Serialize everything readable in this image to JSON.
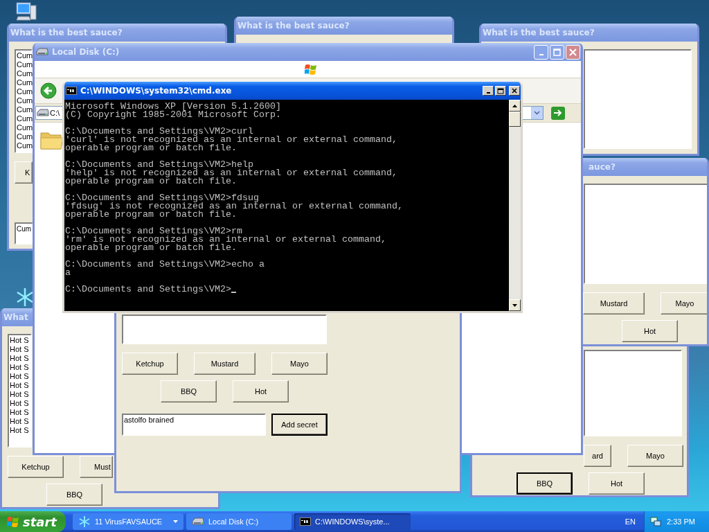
{
  "desktop": {
    "windows": [
      {
        "kind": "console",
        "title": "C:\\WINDOWS\\system32\\cmd.exe",
        "active": true,
        "blocks": [
          [
            "Microsoft Windows XP [Version 5.1.2600]",
            "(C) Copyright 1985-2001 Microsoft Corp."
          ],
          [
            "C:\\Documents and Settings\\VM2>curl",
            "'curl' is not recognized as an internal or external command,",
            "operable program or batch file."
          ],
          [
            "C:\\Documents and Settings\\VM2>help",
            "'help' is not recognized as an internal or external command,",
            "operable program or batch file."
          ],
          [
            "C:\\Documents and Settings\\VM2>fdsug",
            "'fdsug' is not recognized as an internal or external command,",
            "operable program or batch file."
          ],
          [
            "C:\\Documents and Settings\\VM2>rm",
            "'rm' is not recognized as an internal or external command,",
            "operable program or batch file."
          ],
          [
            "C:\\Documents and Settings\\VM2>echo a",
            "a"
          ],
          [
            "C:\\Documents and Settings\\VM2>"
          ]
        ]
      },
      {
        "kind": "sauce",
        "active": false,
        "buttons": [
          {
            "label": "Ketchup",
            "focused": false
          },
          {
            "label": "Mustard",
            "focused": false
          },
          {
            "label": "Mayo",
            "focused": false
          },
          {
            "label": "BBQ",
            "focused": false
          },
          {
            "label": "Hot",
            "focused": false
          }
        ],
        "field": {
          "value": "astolfo brained"
        },
        "submit_button": {
          "label": "Add secret",
          "focused": true
        }
      },
      {
        "kind": "explorer",
        "title": "Local Disk (C:)",
        "active": false,
        "address": "C:\\"
      },
      {
        "kind": "sauce",
        "title": "What",
        "active": false,
        "list_items": [
          "Hot S",
          "Hot S",
          "Hot S",
          "Hot S",
          "Hot S",
          "Hot S",
          "Hot S",
          "Hot S",
          "Hot S",
          "Hot S",
          "Hot S"
        ],
        "buttons": [
          {
            "label": "Ketchup",
            "focused": false
          },
          {
            "label": "Must",
            "focused": false
          },
          {
            "label": "BBQ",
            "focused": false
          }
        ]
      },
      {
        "kind": "sauce",
        "title": "auce?",
        "active": false,
        "buttons": [
          {
            "label": "Mustard",
            "focused": false
          },
          {
            "label": "Mayo",
            "focused": false
          },
          {
            "label": "Hot",
            "focused": false
          }
        ]
      },
      {
        "kind": "sauce",
        "active": false,
        "buttons": [
          {
            "label": "ard",
            "focused": false
          },
          {
            "label": "Mayo",
            "focused": false
          },
          {
            "label": "BBQ",
            "focused": true
          },
          {
            "label": "Hot",
            "focused": false
          }
        ]
      },
      {
        "kind": "sauce",
        "title": "What is the best sauce?",
        "active": false
      },
      {
        "kind": "sauce",
        "title": "What is the best sauce?",
        "active": false
      },
      {
        "kind": "sauce",
        "title": "What is the best sauce?",
        "active": false,
        "list_items": [
          "Cum",
          "Cum",
          "Cum",
          "Cum",
          "Cum",
          "Cum",
          "Cum",
          "Cum",
          "Cum",
          "Cum",
          "Cum"
        ],
        "buttons": [
          {
            "label": "K",
            "focused": false
          }
        ],
        "field": {
          "value": "Cum"
        }
      }
    ]
  },
  "taskbar": {
    "start_label": "start",
    "tasks": [
      {
        "kind": "group",
        "label": "11 VirusFAVSAUCE",
        "selected": false
      },
      {
        "kind": "explorer",
        "label": "Local Disk (C:)",
        "selected": false
      },
      {
        "kind": "console",
        "label": "C:\\WINDOWS\\syste...",
        "selected": true
      }
    ],
    "language": "EN",
    "clock": "2:33 PM"
  }
}
